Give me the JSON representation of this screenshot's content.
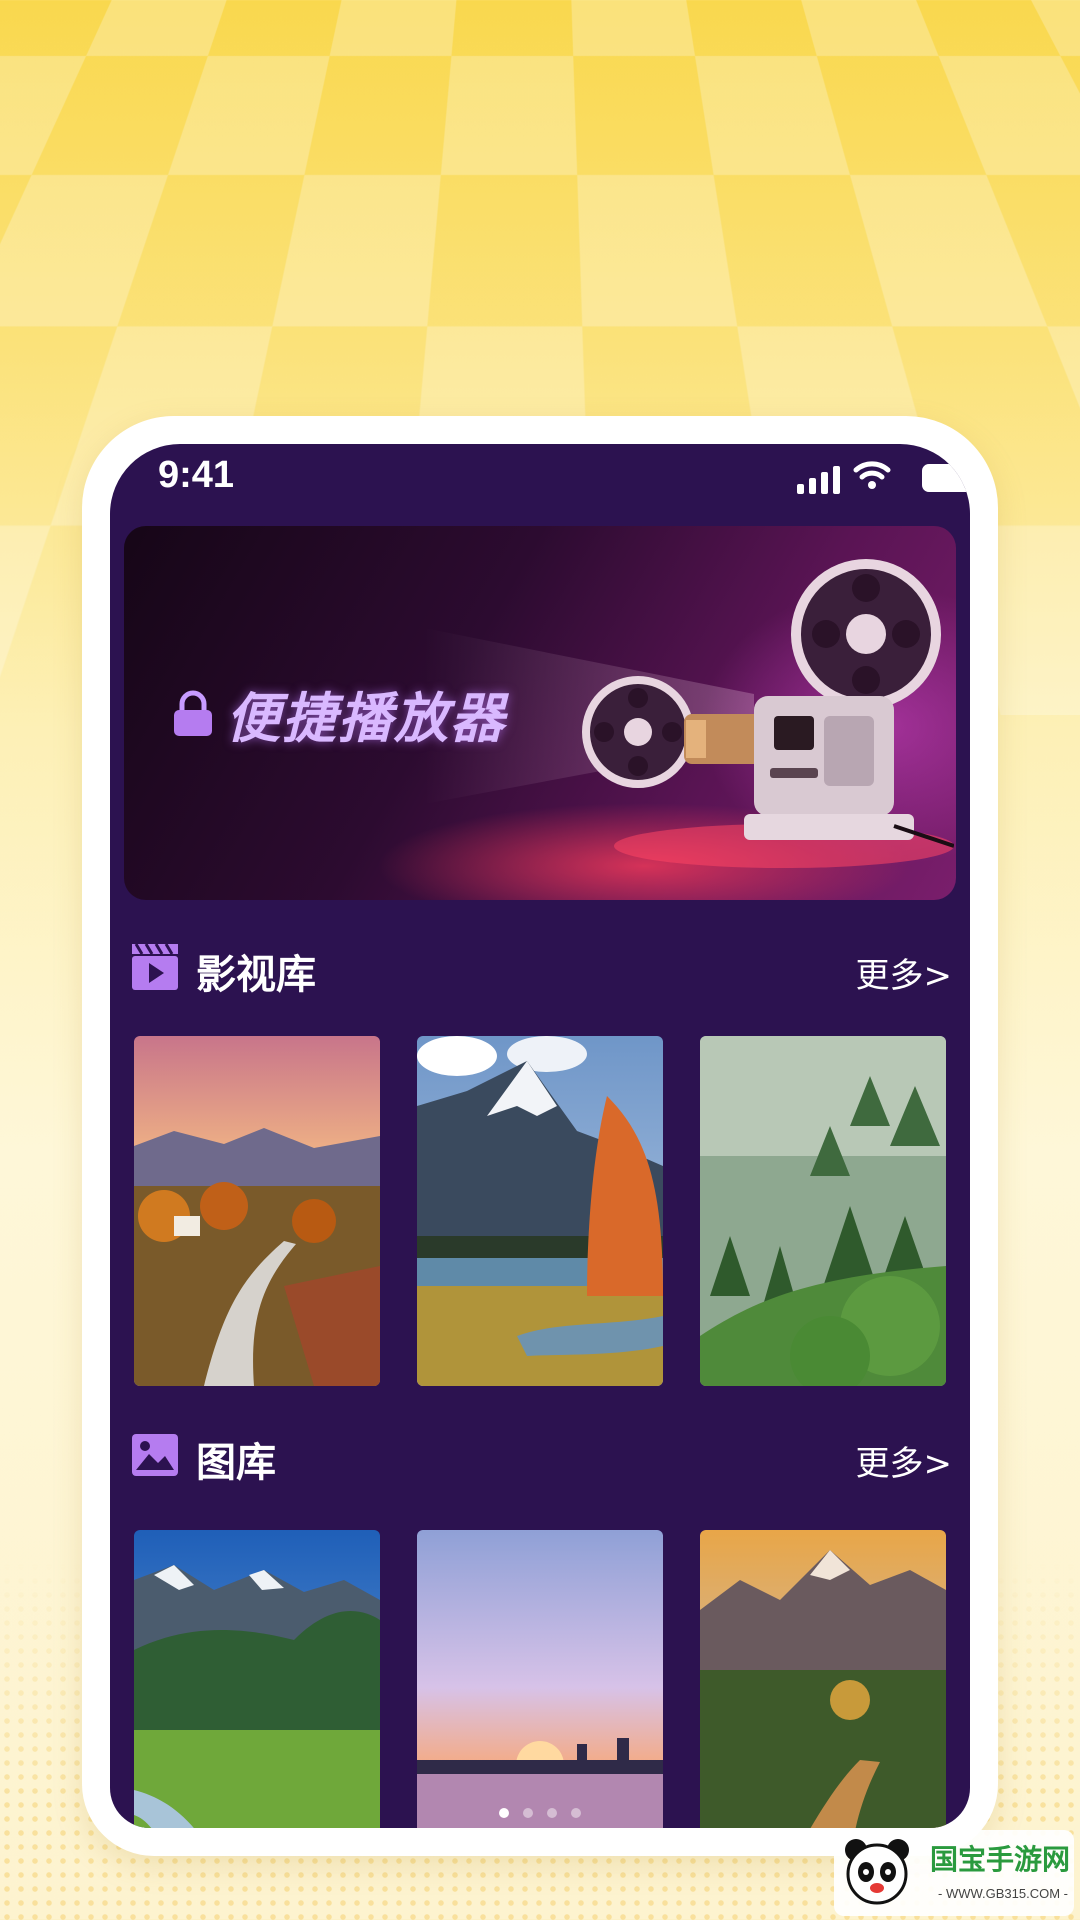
{
  "status_bar": {
    "time": "9:41"
  },
  "banner": {
    "title": "便捷播放器",
    "icon": "lock-icon"
  },
  "sections": [
    {
      "title": "影视库",
      "icon": "video-library-icon",
      "more_label": "更多>"
    },
    {
      "title": "图库",
      "icon": "gallery-icon",
      "more_label": "更多>"
    }
  ],
  "pager": {
    "count": 4,
    "active_index": 0
  },
  "watermark": {
    "text": "国宝手游网",
    "url": "- WWW.GB315.COM -"
  },
  "colors": {
    "screen_bg": "#2c1250",
    "accent_purple": "#b57cf0",
    "background_yellow": "#f9d84e"
  }
}
